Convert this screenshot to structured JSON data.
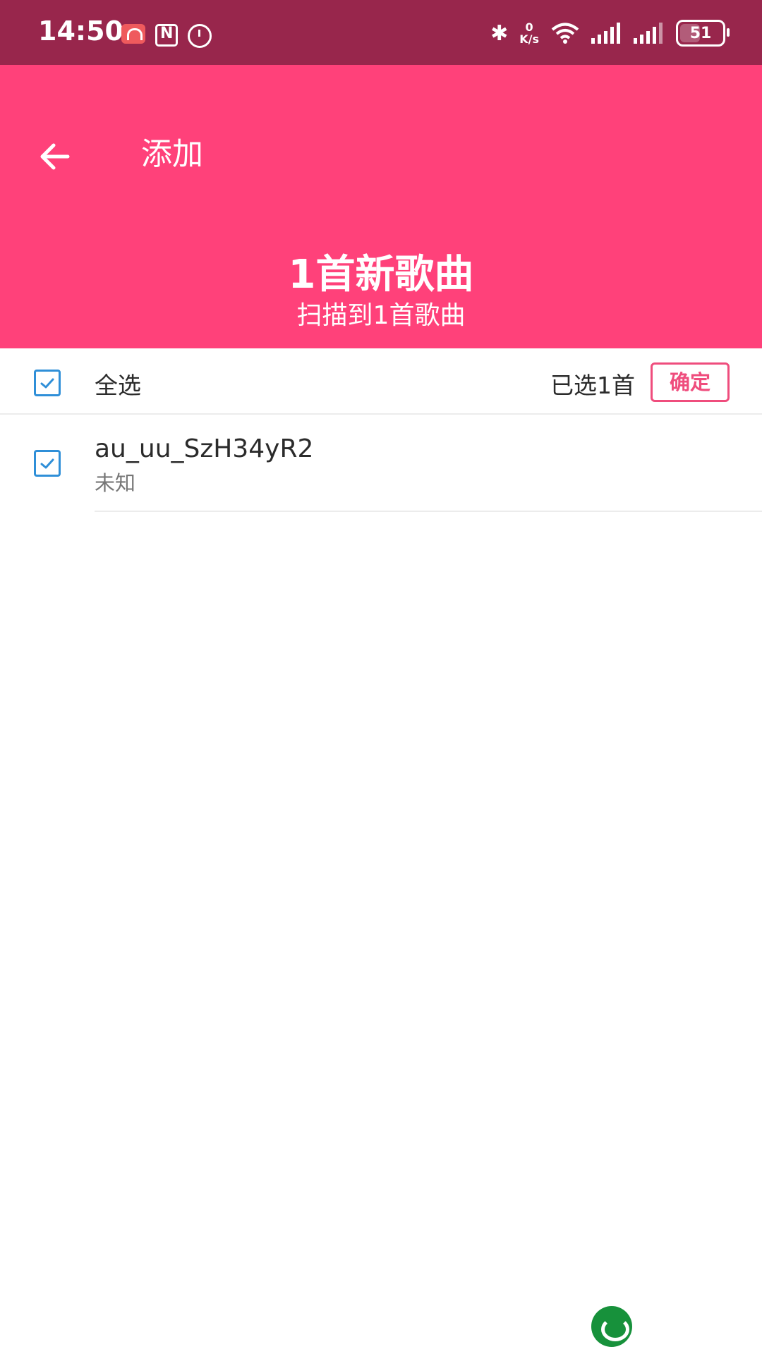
{
  "status_bar": {
    "time": "14:50",
    "net_speed_value": "0",
    "net_speed_unit": "K/s",
    "battery_level": "51",
    "icons": [
      "headphones-icon",
      "nfc-icon",
      "alarm-icon",
      "bluetooth-icon",
      "wifi-icon",
      "signal-icon",
      "signal-icon",
      "battery-icon"
    ]
  },
  "header": {
    "title": "添加",
    "back_icon": "arrow-left-icon",
    "headline": "1首新歌曲",
    "subline": "扫描到1首歌曲",
    "background": "#ff417a"
  },
  "selection": {
    "select_all_label": "全选",
    "select_all_checked": true,
    "selected_count_text": "已选1首",
    "confirm_label": "确定"
  },
  "songs": [
    {
      "title": "au_uu_SzH34yR2",
      "artist": "未知",
      "checked": true
    }
  ],
  "colors": {
    "status_bar": "#98264c",
    "accent": "#ff417a",
    "checkbox": "#2f8fd8",
    "logo": "#17913b"
  }
}
